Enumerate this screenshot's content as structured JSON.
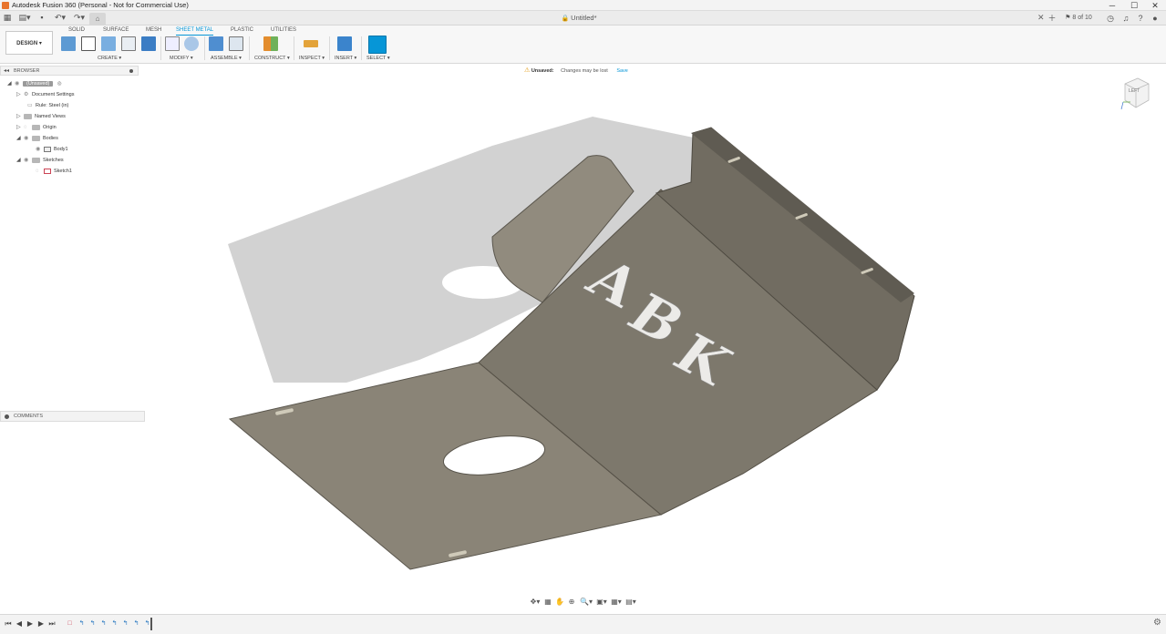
{
  "app": {
    "title": "Autodesk Fusion 360 (Personal - Not for Commercial Use)",
    "document_tab": "Untitled*",
    "job_status": "8 of 10",
    "accent_color": "#0696d7",
    "warning_color": "#e39b13"
  },
  "window_controls": {
    "minimize": "─",
    "maximize": "☐",
    "close": "✕"
  },
  "icons": {
    "data_panel": "grid-icon",
    "file": "file-icon",
    "save": "save-icon",
    "undo": "undo-icon",
    "redo": "redo-icon",
    "home": "home-icon",
    "new_tab": "plus-icon",
    "notifications": "bell-icon",
    "help": "help-icon",
    "account": "avatar-icon"
  },
  "ribbon": {
    "workspace": "DESIGN ▾",
    "tabs": [
      {
        "label": "SOLID"
      },
      {
        "label": "SURFACE"
      },
      {
        "label": "MESH"
      },
      {
        "label": "SHEET METAL",
        "active": true
      },
      {
        "label": "PLASTIC"
      },
      {
        "label": "UTILITIES"
      }
    ],
    "groups": {
      "create": "CREATE ▾",
      "modify": "MODIFY ▾",
      "assemble": "ASSEMBLE ▾",
      "construct": "CONSTRUCT ▾",
      "inspect": "INSPECT ▾",
      "insert": "INSERT ▾",
      "select": "SELECT ▾"
    }
  },
  "alert": {
    "icon": "⚠",
    "title": "Unsaved:",
    "message": "Changes may be lost",
    "action": "Save"
  },
  "browser": {
    "title": "BROWSER",
    "collapse_glyph": "◂◂",
    "root": "(Unsaved)",
    "items": [
      {
        "label": "Document Settings"
      },
      {
        "label": "Rule: Steel (in)"
      },
      {
        "label": "Named Views"
      },
      {
        "label": "Origin"
      },
      {
        "label": "Bodies"
      },
      {
        "label": "Body1"
      },
      {
        "label": "Sketches"
      },
      {
        "label": "Sketch1"
      }
    ]
  },
  "comments": {
    "title": "COMMENTS"
  },
  "viewport": {
    "text_on_part": [
      "A",
      "B",
      "K"
    ],
    "viewcube_label": "LEFT",
    "part_color": "#8a8477",
    "shadow_color": "#cfcfcf"
  },
  "navbar": {
    "glyphs": [
      "✥▾",
      "▦",
      "✋",
      "⊕",
      "🔍▾",
      "▣▾",
      "▦▾",
      "▤▾"
    ]
  },
  "timeline": {
    "controls": [
      "⏮",
      "◀",
      "▶",
      "▶",
      "⏭"
    ],
    "features": [
      "□",
      "↰",
      "↰",
      "↰",
      "↰",
      "↰",
      "↰",
      "↰"
    ],
    "settings": "⚙"
  }
}
